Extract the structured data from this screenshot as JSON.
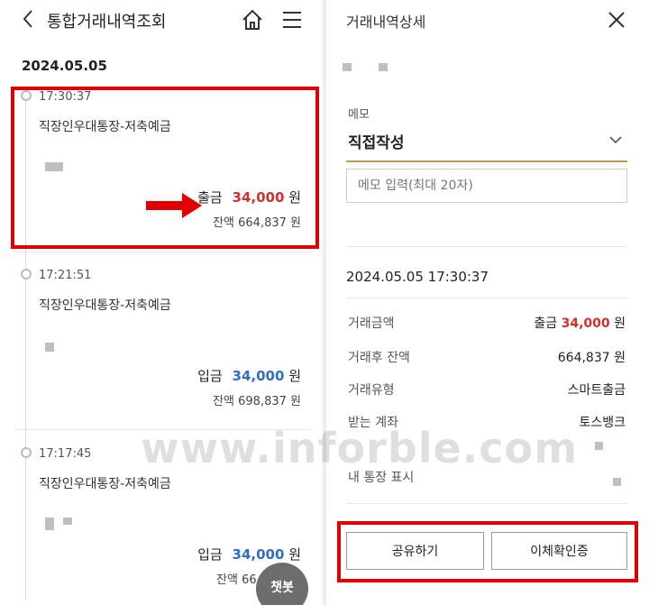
{
  "left": {
    "header_title": "통합거래내역조회",
    "date": "2024.05.05",
    "transactions": [
      {
        "time": "17:30:37",
        "account": "직장인우대통장-저축예금",
        "type": "출금",
        "amount": "34,000",
        "unit": "원",
        "balance_label": "잔액",
        "balance": "664,837",
        "balance_unit": "원"
      },
      {
        "time": "17:21:51",
        "account": "직장인우대통장-저축예금",
        "type": "입금",
        "amount": "34,000",
        "unit": "원",
        "balance_label": "잔액",
        "balance": "698,837",
        "balance_unit": "원"
      },
      {
        "time": "17:17:45",
        "account": "직장인우대통장-저축예금",
        "type": "입금",
        "amount": "34,000",
        "unit": "원",
        "balance_label": "잔액",
        "balance": "66",
        "balance_unit": ""
      }
    ],
    "chatbot_label": "챗봇"
  },
  "right": {
    "header_title": "거래내역상세",
    "memo_label": "메모",
    "memo_select_value": "직접작성",
    "memo_placeholder": "메모 입력(최대 20자)",
    "datetime": "2024.05.05 17:30:37",
    "details": [
      {
        "label": "거래금액",
        "prefix": "출금",
        "value": "34,000",
        "unit": "원"
      },
      {
        "label": "거래후 잔액",
        "prefix": "",
        "value": "664,837",
        "unit": "원"
      },
      {
        "label": "거래유형",
        "prefix": "",
        "value": "스마트출금",
        "unit": ""
      },
      {
        "label": "받는 계좌",
        "prefix": "",
        "value": "토스뱅크",
        "unit": ""
      },
      {
        "label": "내 통장 표시",
        "prefix": "",
        "value": "",
        "unit": ""
      }
    ],
    "share_button": "공유하기",
    "transfer_confirm_button": "이체확인증"
  },
  "watermark": "www.inforble.com",
  "colors": {
    "withdraw": "#d32f2f",
    "deposit": "#2e6fc4",
    "highlight": "#e00000",
    "memo_underline": "#b59a5a"
  },
  "icons": [
    "back-arrow-icon",
    "home-icon",
    "menu-icon",
    "close-icon",
    "chevron-down-icon",
    "red-arrow-icon"
  ]
}
